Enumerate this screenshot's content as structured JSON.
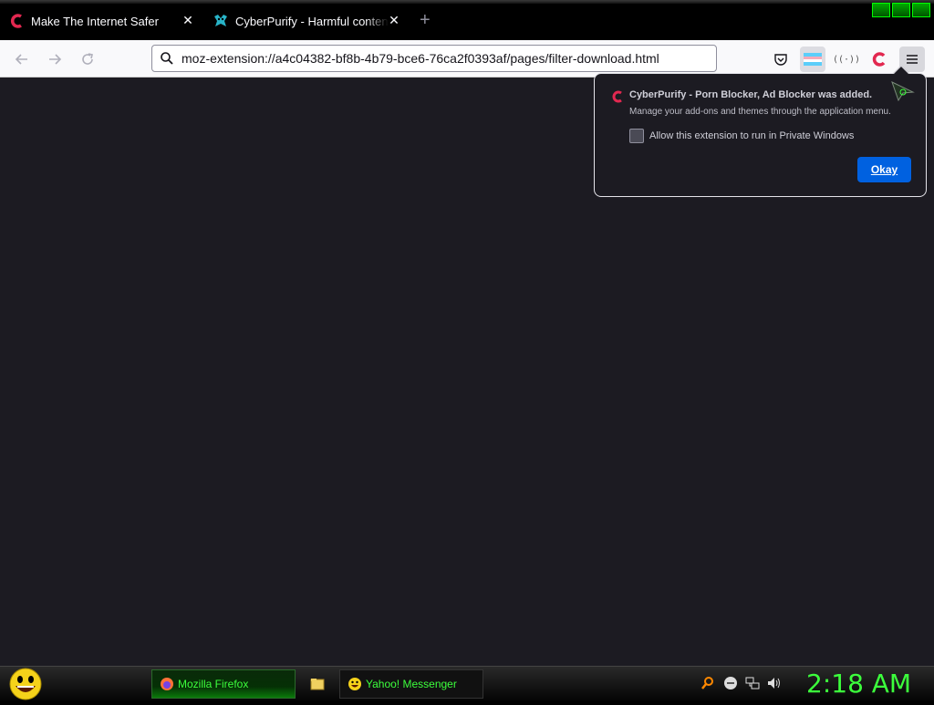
{
  "browser": {
    "tabs": [
      {
        "title": "Make The Internet Safer",
        "icon": "cyberpurify-c-icon",
        "active": true
      },
      {
        "title": "CyberPurify - Harmful content f",
        "icon": "cyberpurify-bird-icon",
        "active": false
      }
    ],
    "url": "moz-extension://a4c04382-bf8b-4b79-bce6-76ca2f0393af/pages/filter-download.html",
    "toolbar_icons": [
      "pocket-icon",
      "extension-flag-icon",
      "extension-dots-icon",
      "cyberpurify-extension-icon",
      "menu-icon"
    ],
    "ext_dots_text": "((·))"
  },
  "popup": {
    "title": "CyberPurify - Porn Blocker, Ad Blocker was added.",
    "subtitle": "Manage your add-ons and themes through the application menu.",
    "checkbox_label": "Allow this extension to run in Private Windows",
    "checkbox_checked": false,
    "okay_label": "Okay"
  },
  "taskbar": {
    "tasks": [
      {
        "label": "Mozilla Firefox",
        "active": true
      },
      {
        "label": "Yahoo! Messenger",
        "active": false
      }
    ],
    "clock": "2:18 AM"
  },
  "colors": {
    "accent_blue": "#0061e0",
    "cyberpurify_red": "#e22850",
    "taskbar_green": "#3cff3c",
    "content_bg": "#1c1b22"
  }
}
